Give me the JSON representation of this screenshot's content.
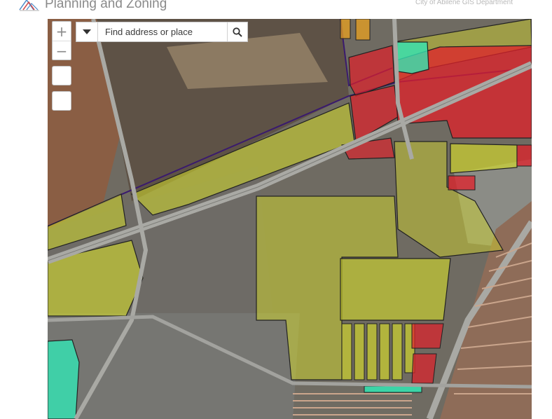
{
  "header": {
    "title": "Planning and Zoning",
    "department": "City of Abilene GIS Department",
    "logo_icon": "city-logo-icon"
  },
  "map_controls": {
    "zoom_in_label": "+",
    "zoom_out_label": "−",
    "tool1_icon": "blank-tool-icon",
    "tool2_icon": "blank-tool-icon"
  },
  "search": {
    "value": "",
    "placeholder": "Find address or place",
    "dropdown_icon": "caret-down-icon",
    "submit_icon": "search-icon"
  },
  "colors": {
    "zone_yellow": "#d6dc2a",
    "zone_red": "#e0202a",
    "zone_teal": "#33e6b4",
    "zone_orange": "#e8a020",
    "boundary_purple": "#3a1a6e",
    "highway": "#a9a9a4"
  }
}
